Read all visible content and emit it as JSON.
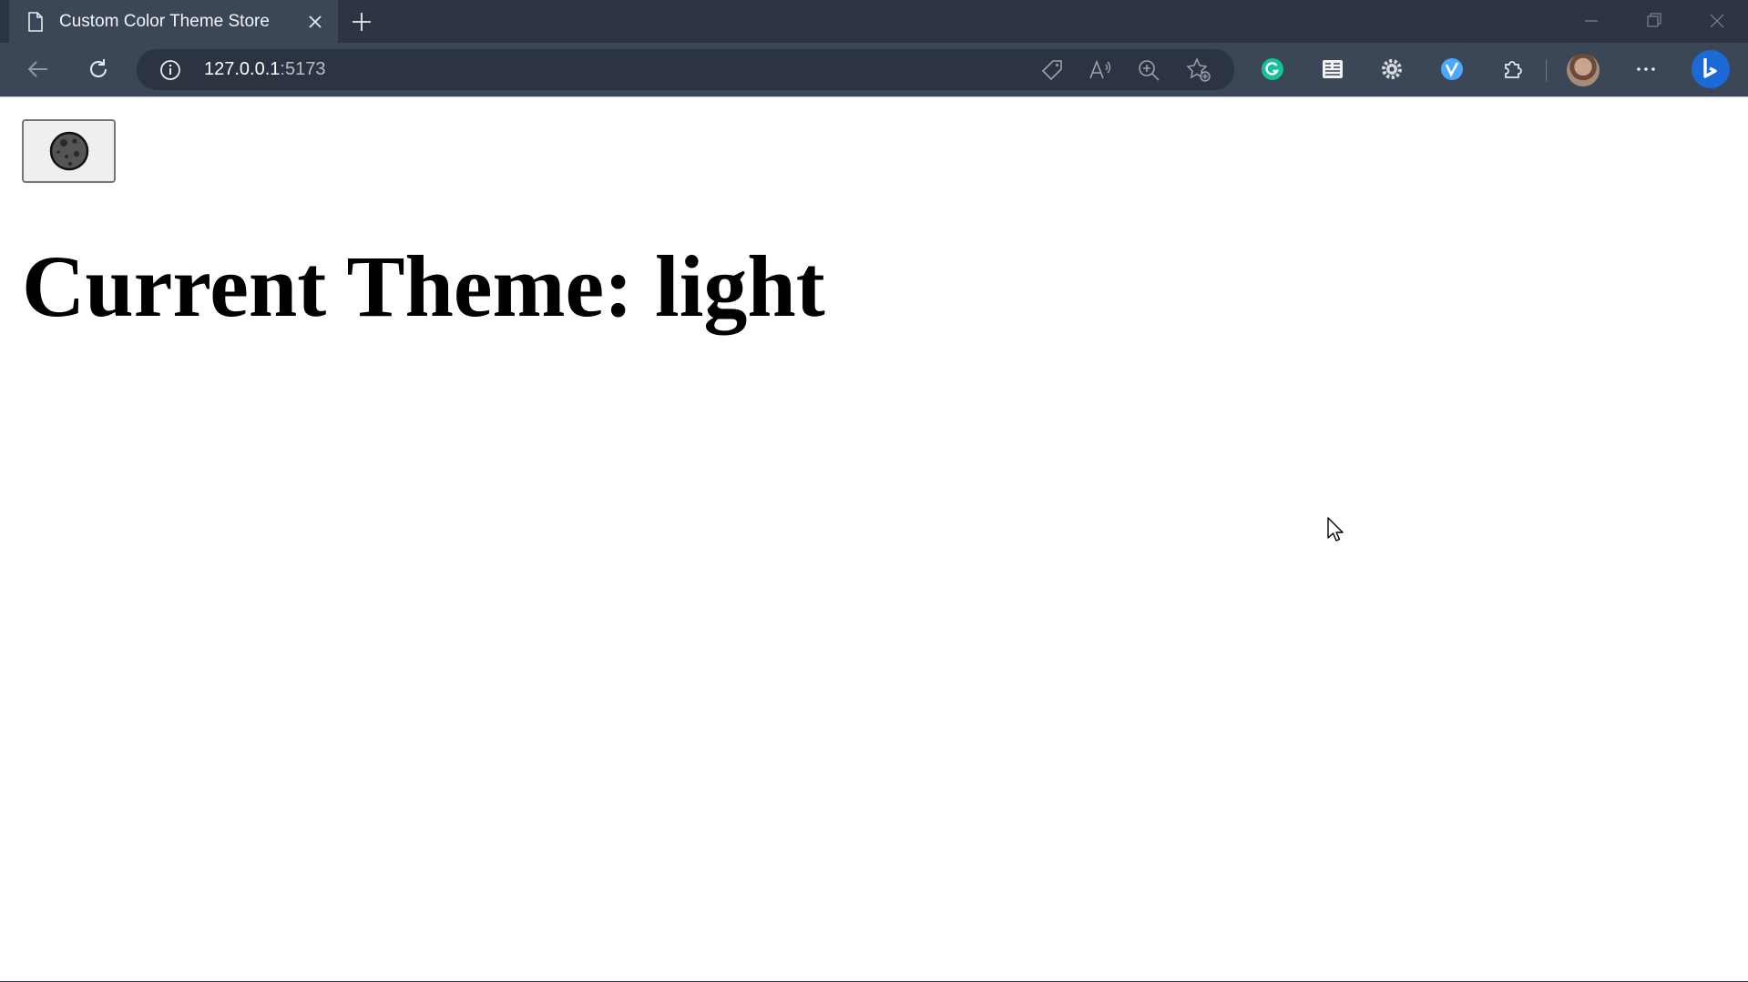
{
  "browser": {
    "tab": {
      "title": "Custom Color Theme Store",
      "page_icon": "page-icon",
      "close_icon": "close-icon"
    },
    "new_tab_icon": "plus-icon",
    "window_controls": [
      "minimize-icon",
      "maximize-icon",
      "close-icon"
    ],
    "address_bar": {
      "host": "127.0.0.1",
      "port": ":5173",
      "icons": [
        "info-icon",
        "tag-icon",
        "read-aloud-icon",
        "zoom-icon",
        "add-favorite-icon"
      ]
    },
    "extensions": [
      "grammarly-icon",
      "reader-icon",
      "gear-icon",
      "vpn-icon",
      "puzzle-icon"
    ],
    "colors": {
      "tabstrip": "#2b3440",
      "toolbar": "#3b4756",
      "grammarly": "#15c39a",
      "vpn": "#4aa8ff",
      "bing": "#1b6ad8"
    }
  },
  "page": {
    "theme_toggle_icon": "moon-icon",
    "heading": "Current Theme: light"
  }
}
